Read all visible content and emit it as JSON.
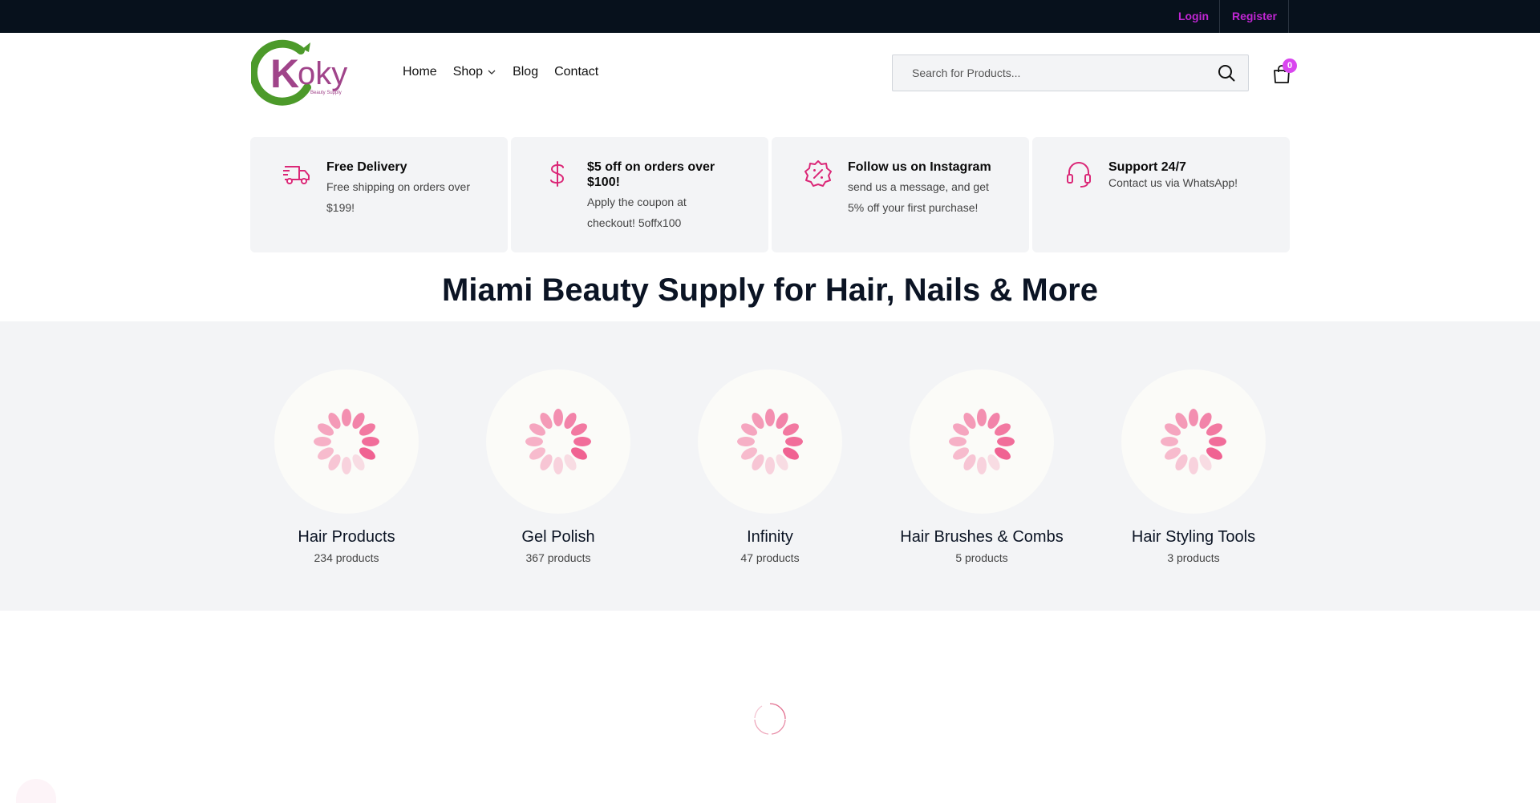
{
  "topbar": {
    "login_label": "Login",
    "register_label": "Register"
  },
  "brand": {
    "logo_text": "Koky",
    "logo_subtext": "Beauty Supply"
  },
  "nav": {
    "items": [
      {
        "label": "Home"
      },
      {
        "label": "Shop"
      },
      {
        "label": "Blog"
      },
      {
        "label": "Contact"
      }
    ]
  },
  "search": {
    "placeholder": "Search for Products...",
    "value": ""
  },
  "cart": {
    "count": "0"
  },
  "features": [
    {
      "icon": "delivery-truck-icon",
      "title": "Free Delivery",
      "desc": "Free shipping on orders over $199!"
    },
    {
      "icon": "dollar-icon",
      "title": "$5 off on orders over $100!",
      "desc": "Apply the coupon at checkout! 5offx100"
    },
    {
      "icon": "percent-badge-icon",
      "title": "Follow us on Instagram",
      "desc": "send us a message, and get 5% off your first purchase!"
    },
    {
      "icon": "headset-icon",
      "title": "Support 24/7",
      "desc": "Contact us via WhatsApp!"
    }
  ],
  "hero": {
    "title": "Miami Beauty Supply for Hair, Nails & More"
  },
  "categories": [
    {
      "name": "Hair Products",
      "count": "234 products"
    },
    {
      "name": "Gel Polish",
      "count": "367 products"
    },
    {
      "name": "Infinity",
      "count": "47 products"
    },
    {
      "name": "Hair Brushes & Combs",
      "count": "5 products"
    },
    {
      "name": "Hair Styling Tools",
      "count": "3 products"
    }
  ],
  "colors": {
    "accent": "#c026d3",
    "icon_pink": "#db2777",
    "topbar_bg": "#07111c",
    "section_bg": "#f3f4f6"
  }
}
